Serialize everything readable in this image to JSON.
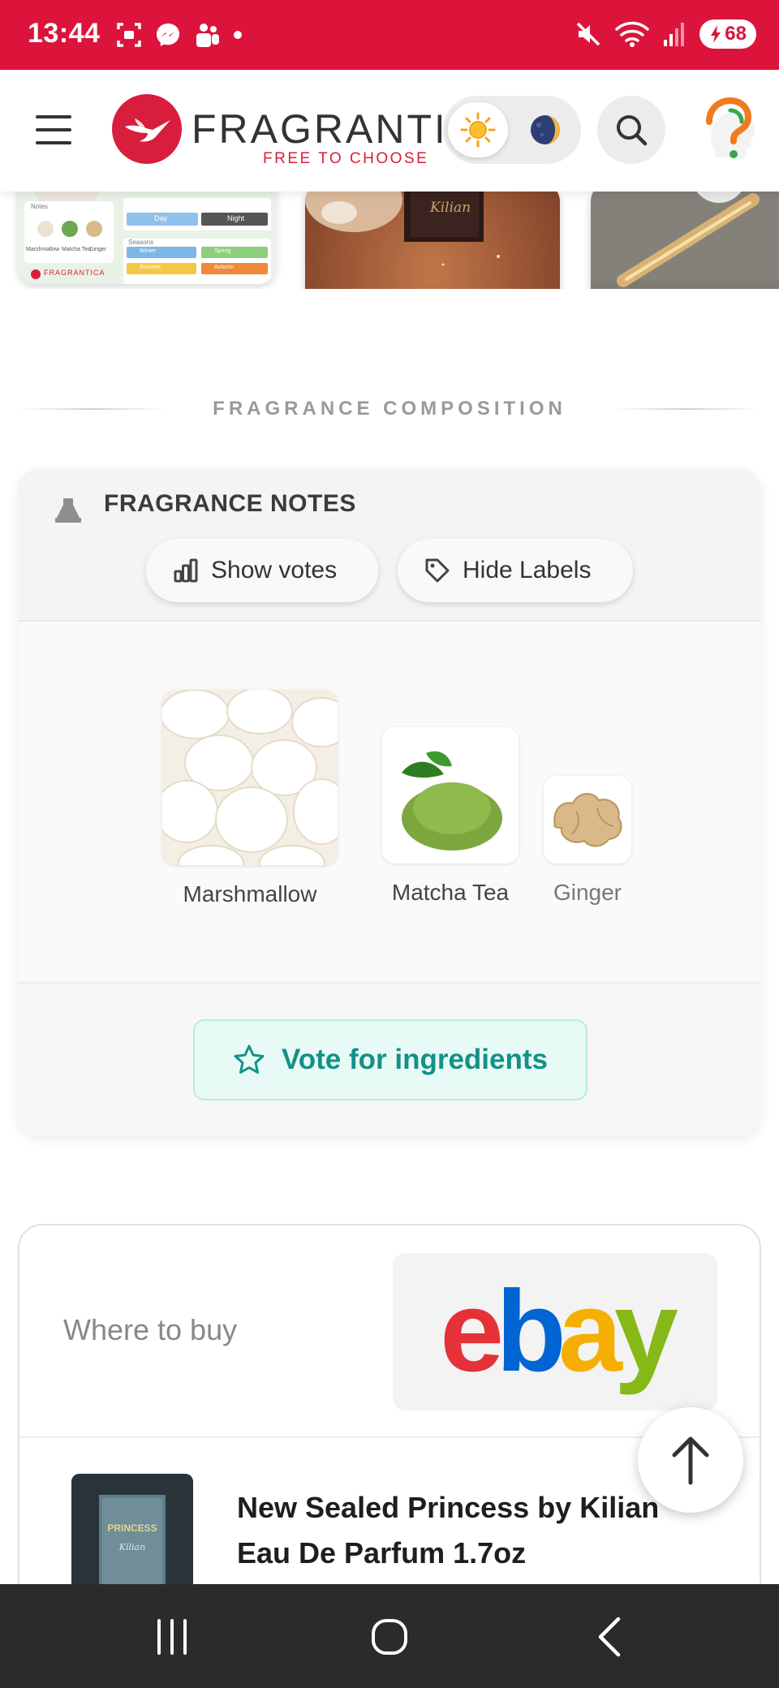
{
  "status_bar": {
    "time": "13:44",
    "battery": "68",
    "left_icons": [
      "screenshot-icon",
      "messenger-icon",
      "teams-icon",
      "dot-icon"
    ],
    "right_icons": [
      "mute-icon",
      "wifi-icon",
      "signal-icon",
      "battery-icon"
    ]
  },
  "header": {
    "logo_text": "FRAGRANTICA",
    "tagline": "FREE TO CHOOSE",
    "theme_toggle": {
      "day_icon": "sun-icon",
      "night_icon": "moon-icon",
      "selected": "day"
    },
    "search_icon": "search-icon",
    "menu_icon": "hamburger-icon"
  },
  "carousel": {
    "card_a": {
      "day_label": "Day",
      "night_label": "Night",
      "notes_heading": "Notes",
      "seasons_heading": "Seasons",
      "notes": [
        "Marshmallow",
        "Matcha Tea",
        "Ginger"
      ],
      "seasons": [
        "Winter",
        "Spring",
        "Summer",
        "Autumn"
      ],
      "brand": "FRAGRANTICA"
    },
    "card_b": {
      "bottle_text": "Kilian"
    }
  },
  "section": {
    "heading": "FRAGRANCE COMPOSITION"
  },
  "notes_panel": {
    "title": "FRAGRANCE NOTES",
    "show_votes_label": "Show votes",
    "hide_labels_label": "Hide Labels",
    "notes": [
      {
        "name": "Marshmallow",
        "image": "marshmallow"
      },
      {
        "name": "Matcha Tea",
        "image": "matcha-tea"
      },
      {
        "name": "Ginger",
        "image": "ginger"
      }
    ],
    "vote_button_label": "Vote for ingredients"
  },
  "buy_panel": {
    "label": "Where to buy",
    "store_logo": "ebay",
    "product_title": "New Sealed Princess by Kilian\nEau De Parfum 1.7oz",
    "product_box_brand": "PRINCESS",
    "product_box_maker": "Kilian"
  },
  "colors": {
    "brand_red": "#dc143c",
    "teal": "#139187",
    "ebay_red": "#e53238",
    "ebay_blue": "#0064d2",
    "ebay_yellow": "#f5af02",
    "ebay_green": "#86b817"
  }
}
